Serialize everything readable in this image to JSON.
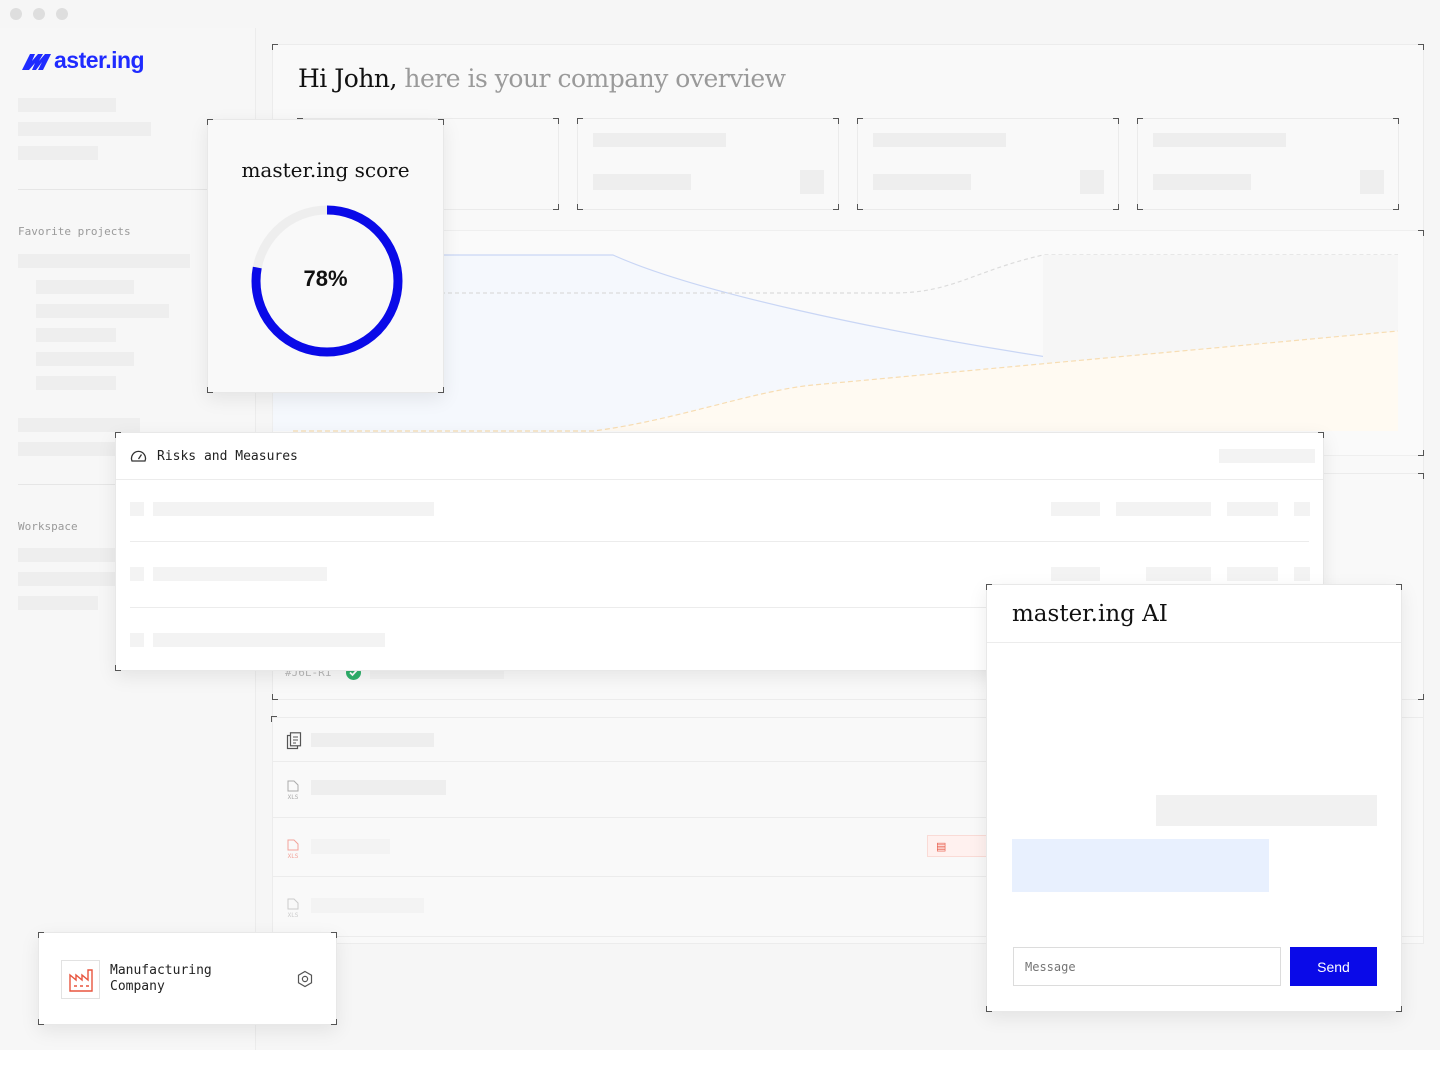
{
  "brand": {
    "logo_text": "aster.ing",
    "color": "#1f2bff"
  },
  "sidebar": {
    "favorite_projects_label": "Favorite projects",
    "workspace_label": "Workspace"
  },
  "greeting": {
    "name": "Hi John,",
    "rest": "here is your company overview"
  },
  "score_card": {
    "title": "master.ing score",
    "percent_text": "78%",
    "value": 0.78,
    "color": "#0a0ae8"
  },
  "risks": {
    "title": "Risks and Measures",
    "risk_id": "#J6L-R1"
  },
  "files": {
    "file_type": "XLS"
  },
  "ai": {
    "title": "master.ing AI",
    "message_placeholder": "Message",
    "send_label": "Send"
  },
  "company": {
    "name": "Manufacturing Company"
  }
}
